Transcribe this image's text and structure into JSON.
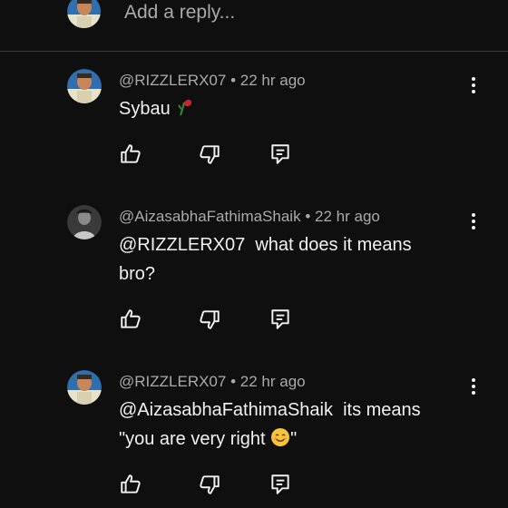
{
  "reply_bar": {
    "placeholder": "Add a reply..."
  },
  "comments": [
    {
      "author": "@RIZZLERX07",
      "separator": "•",
      "time": "22 hr ago",
      "text_lines": [
        "Sybau "
      ],
      "emoji": "wilted-rose-icon"
    },
    {
      "author": "@AizasabhaFathimaShaik",
      "separator": "•",
      "time": "22 hr ago",
      "text_lines": [
        "@RIZZLERX07  what does it means",
        "bro?"
      ]
    },
    {
      "author": "@RIZZLERX07",
      "separator": "•",
      "time": "22 hr ago",
      "text_lines": [
        "@AizasabhaFathimaShaik  its means",
        "\"you are very right "
      ],
      "trailing_text": "\"",
      "emoji": "smiling-face-icon"
    }
  ],
  "icons": {
    "like": "thumbs-up-icon",
    "dislike": "thumbs-down-icon",
    "reply": "comment-icon",
    "more": "vertical-dots-icon"
  },
  "colors": {
    "background": "#0f0f0f",
    "text_primary": "#f1f1f1",
    "text_secondary": "#aaaaaa",
    "divider": "#3a3a3a"
  }
}
